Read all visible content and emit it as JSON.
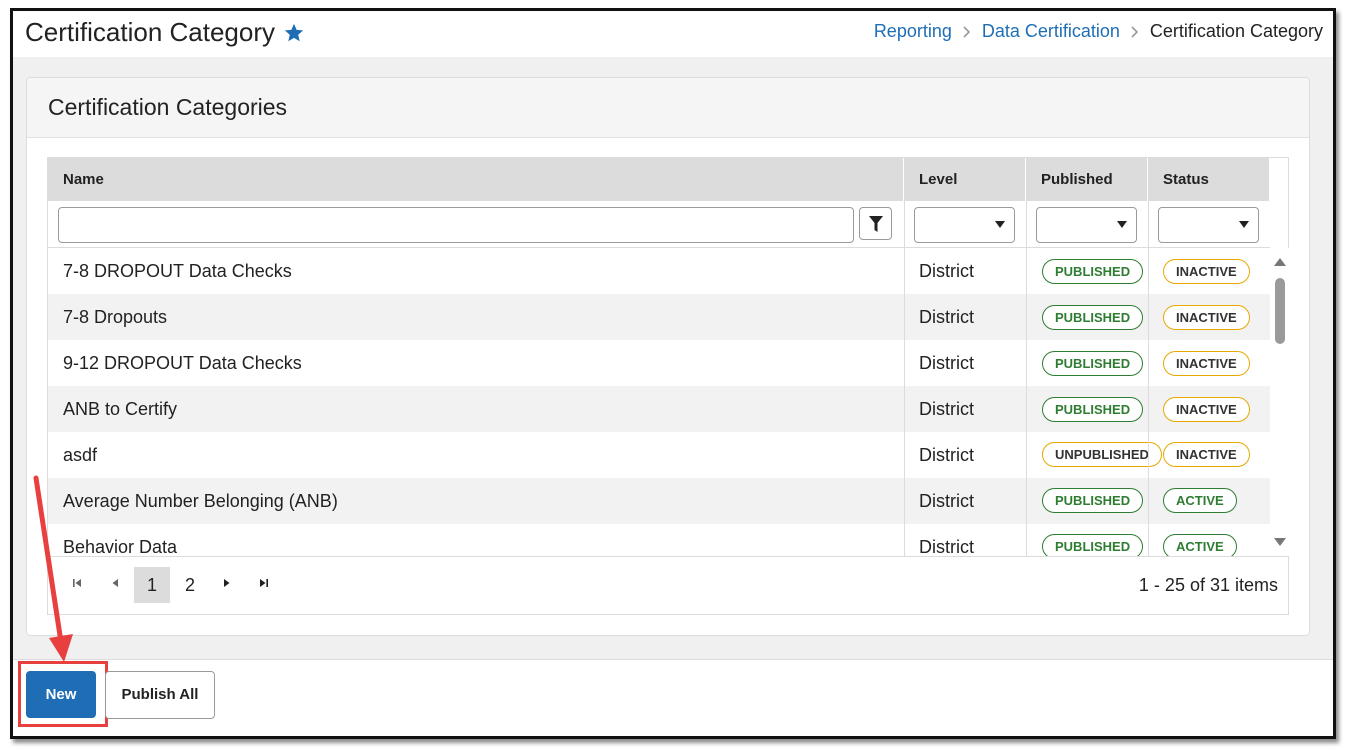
{
  "header": {
    "title": "Certification Category",
    "breadcrumb": [
      "Reporting",
      "Data Certification",
      "Certification Category"
    ]
  },
  "panel": {
    "title": "Certification Categories"
  },
  "grid": {
    "columns": [
      "Name",
      "Level",
      "Published",
      "Status"
    ],
    "rows": [
      {
        "name": "7-8 DROPOUT Data Checks",
        "level": "District",
        "published": "PUBLISHED",
        "status": "INACTIVE"
      },
      {
        "name": "7-8 Dropouts",
        "level": "District",
        "published": "PUBLISHED",
        "status": "INACTIVE"
      },
      {
        "name": "9-12 DROPOUT Data Checks",
        "level": "District",
        "published": "PUBLISHED",
        "status": "INACTIVE"
      },
      {
        "name": "ANB to Certify",
        "level": "District",
        "published": "PUBLISHED",
        "status": "INACTIVE"
      },
      {
        "name": "asdf",
        "level": "District",
        "published": "UNPUBLISHED",
        "status": "INACTIVE"
      },
      {
        "name": "Average Number Belonging (ANB)",
        "level": "District",
        "published": "PUBLISHED",
        "status": "ACTIVE"
      },
      {
        "name": "Behavior Data",
        "level": "District",
        "published": "PUBLISHED",
        "status": "ACTIVE"
      }
    ],
    "pager": {
      "pages": [
        "1",
        "2"
      ],
      "current": "1",
      "info": "1 - 25 of 31 items"
    }
  },
  "footer": {
    "new_label": "New",
    "publish_all_label": "Publish All"
  },
  "colors": {
    "accent": "#1f6eb5",
    "published_green": "#2e7d32",
    "warning_amber": "#e9a800",
    "highlight_red": "#e8403f"
  }
}
